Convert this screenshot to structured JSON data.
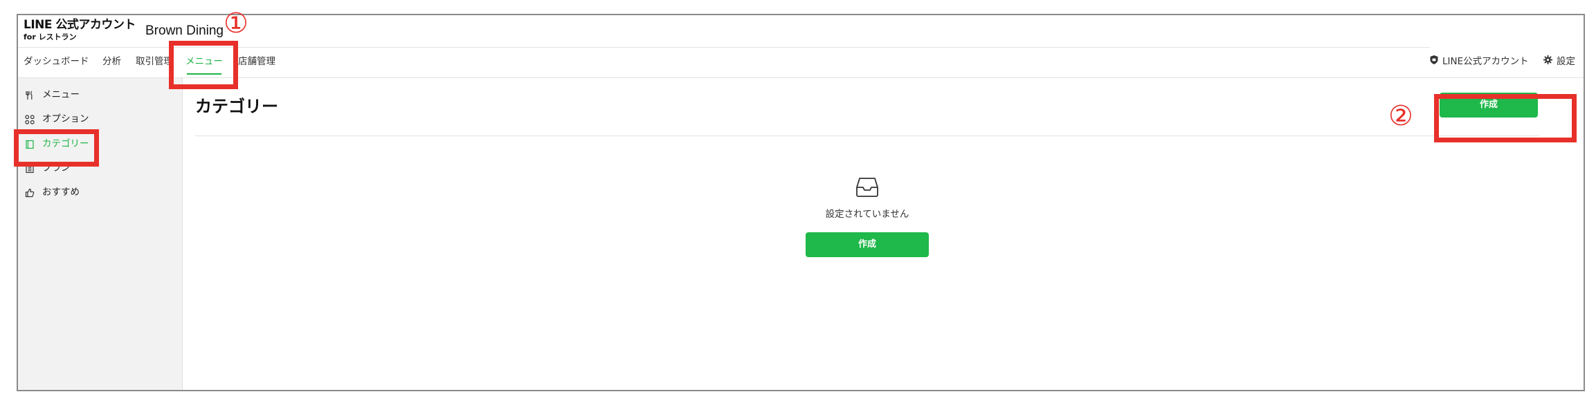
{
  "logo": {
    "line1": "LINE 公式アカウント",
    "line2": "for レストラン"
  },
  "app_name": "Brown Dining",
  "nav": {
    "items": [
      {
        "label": "ダッシュボード"
      },
      {
        "label": "分析"
      },
      {
        "label": "取引管理"
      },
      {
        "label": "メニュー",
        "active": true
      },
      {
        "label": "店舗管理"
      }
    ],
    "right": {
      "account_label": "LINE公式アカウント",
      "settings_label": "設定"
    }
  },
  "sidebar": {
    "items": [
      {
        "label": "メニュー",
        "icon": "fork-knife-icon"
      },
      {
        "label": "オプション",
        "icon": "options-icon"
      },
      {
        "label": "カテゴリー",
        "icon": "category-icon",
        "active": true
      },
      {
        "label": "プラン",
        "icon": "plan-icon"
      },
      {
        "label": "おすすめ",
        "icon": "thumbs-up-icon"
      }
    ]
  },
  "main": {
    "title": "カテゴリー",
    "create_button_label": "作成",
    "empty_state": {
      "icon": "inbox-icon",
      "message": "設定されていません",
      "button_label": "作成"
    }
  },
  "annotations": {
    "step1": "①",
    "step2": "②"
  },
  "colors": {
    "accent_green": "#1fb84a",
    "annotation_red": "#e8302a",
    "sidebar_bg": "#f2f2f2"
  }
}
